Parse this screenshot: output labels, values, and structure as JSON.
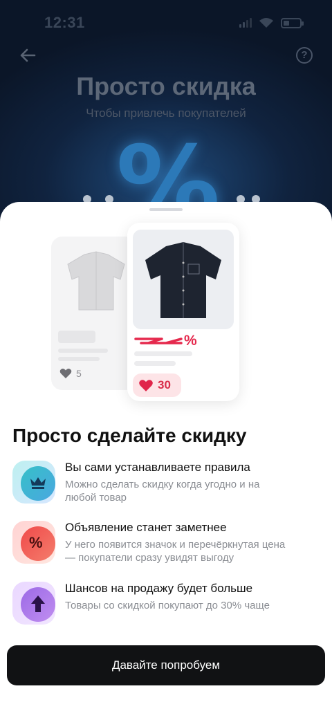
{
  "status_bar": {
    "time": "12:31"
  },
  "header": {
    "back_icon": "arrow-left-icon",
    "help_icon": "question-circle-icon",
    "title": "Просто скидка",
    "subtitle": "Чтобы привлечь покупателей",
    "hero_symbol": "%"
  },
  "preview": {
    "back_card": {
      "likes": "5"
    },
    "front_card": {
      "discount_symbol": "%",
      "likes": "30"
    }
  },
  "headline": "Просто сделайте скидку",
  "features": [
    {
      "icon": "crown-icon",
      "title": "Вы сами устанавливаете правила",
      "description": "Можно сделать скидку когда угодно и на любой товар"
    },
    {
      "icon": "percent-icon",
      "title": "Объявление станет заметнее",
      "description": "У него появится значок и перечёркнутая цена — покупатели сразу увидят выгоду"
    },
    {
      "icon": "arrow-up-icon",
      "title": "Шансов на продажу будет больше",
      "description": "Товары со скидкой покупают до 30% чаще"
    }
  ],
  "cta_label": "Давайте попробуем",
  "colors": {
    "accent_red": "#e5294d",
    "button": "#111214",
    "crown_bg": "#3ec6c9",
    "percent_bg": "#f25a5a",
    "arrow_bg": "#a879e8"
  }
}
